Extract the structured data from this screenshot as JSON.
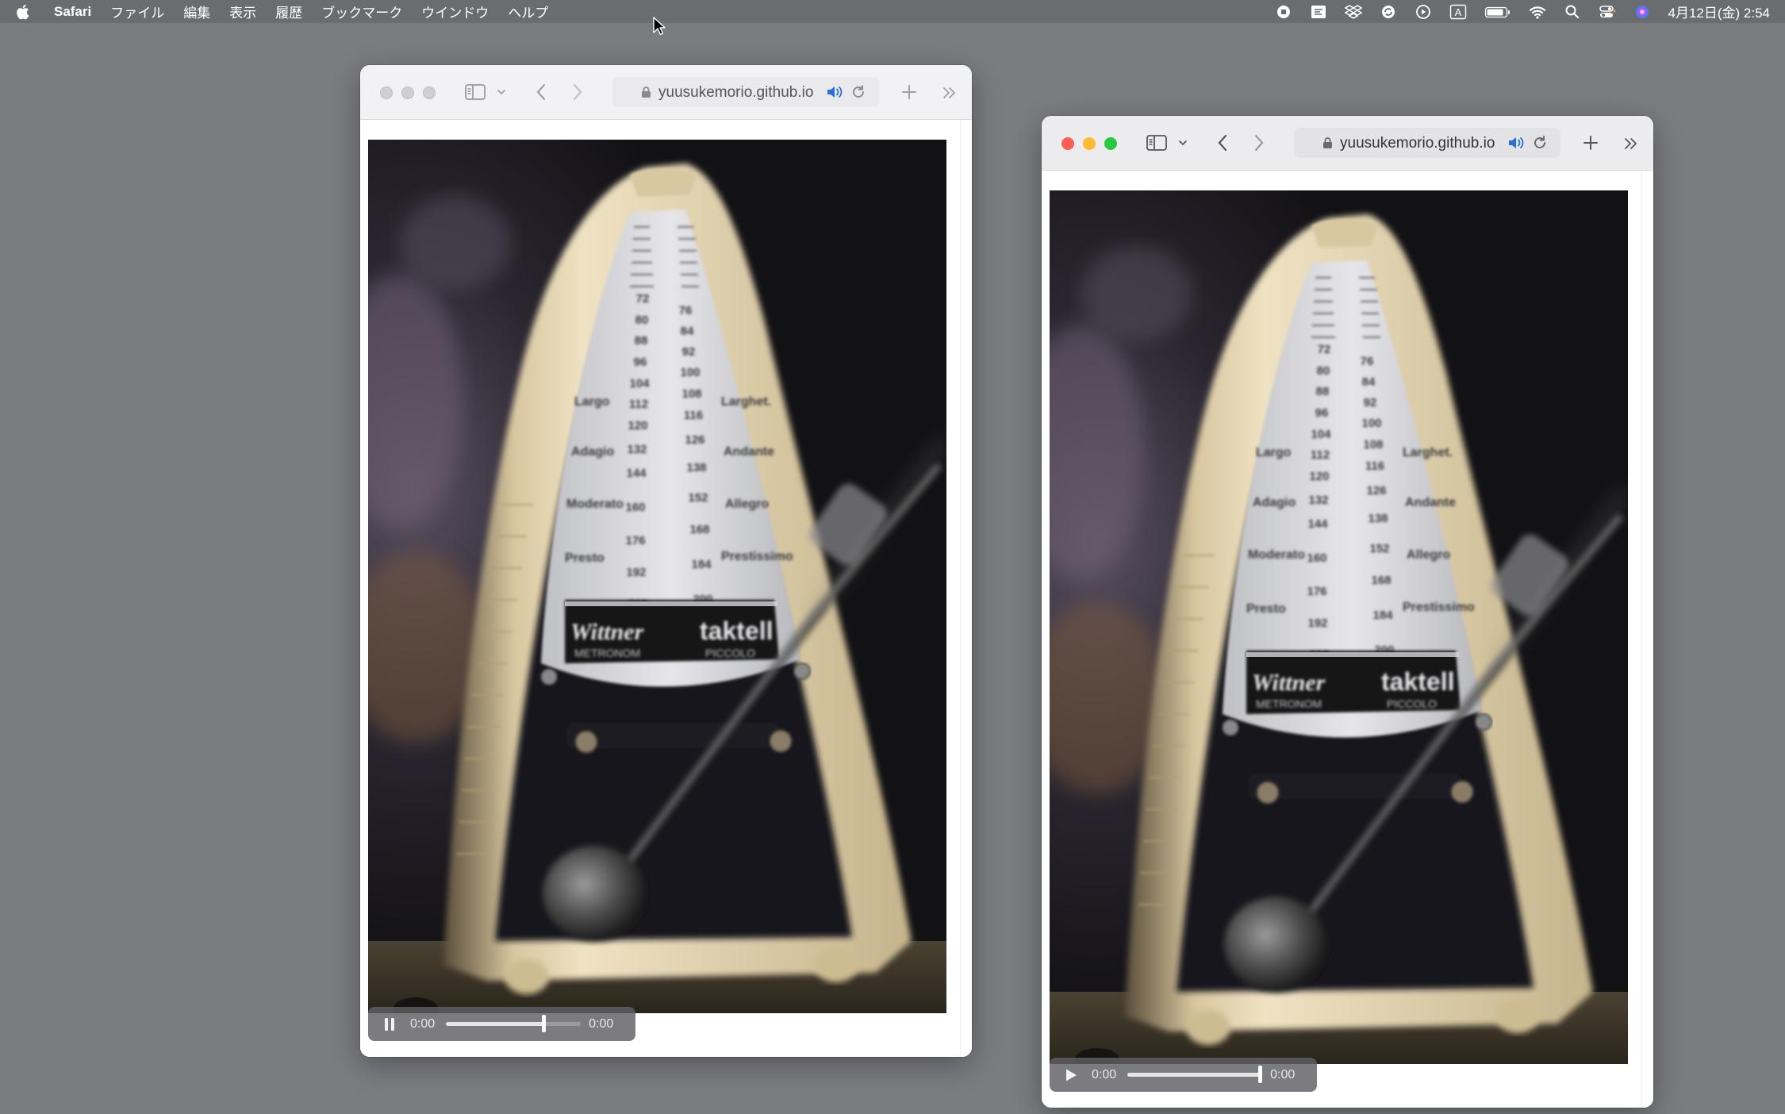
{
  "menubar": {
    "app_name": "Safari",
    "items": [
      "ファイル",
      "編集",
      "表示",
      "履歴",
      "ブックマーク",
      "ウインドウ",
      "ヘルプ"
    ],
    "clock": "4月12日(金) 2:54",
    "status_icons": [
      "stop-record-icon",
      "text-input-icon",
      "dropbox-icon",
      "sync-icon",
      "play-circle-icon",
      "input-source-A-icon",
      "battery-icon",
      "wifi-icon",
      "spotlight-search-icon",
      "control-center-icon",
      "siri-icon"
    ],
    "input_source_letter": "A"
  },
  "windows": [
    {
      "id": "left",
      "state": "inactive",
      "url": "yuusukemorio.github.io",
      "video": {
        "subject": "Wittner taktell metronome",
        "current_time": "0:00",
        "duration": "0:00",
        "playing": true,
        "scrubber_fraction": 0.72
      }
    },
    {
      "id": "right",
      "state": "active",
      "url": "yuusukemorio.github.io",
      "video": {
        "subject": "Wittner taktell metronome",
        "current_time": "0:00",
        "duration": "0:00",
        "playing": false,
        "scrubber_fraction": 0.98
      }
    }
  ],
  "metronome_face": {
    "brand": "Wittner",
    "model": "taktell",
    "sub_brand": "METRONOM",
    "sub_model": "PICCOLO",
    "tempo_terms": [
      "Largo",
      "Adagio",
      "Moderato",
      "Presto",
      "Larghet.",
      "Andante",
      "Allegro",
      "Prestissimo"
    ],
    "scale_left": [
      "72",
      "80",
      "88",
      "96",
      "104",
      "112",
      "120",
      "132",
      "144",
      "160",
      "176",
      "192",
      "208"
    ],
    "scale_right": [
      "76",
      "84",
      "92",
      "100",
      "108",
      "116",
      "126",
      "138",
      "152",
      "168",
      "184",
      "200"
    ]
  },
  "colors": {
    "desktop": "#7b7c80",
    "menubar": "#6b6c70",
    "close": "#ff5f57",
    "minimize": "#febc2e",
    "maximize": "#28c840",
    "audio_icon": "#2a6fd6"
  }
}
